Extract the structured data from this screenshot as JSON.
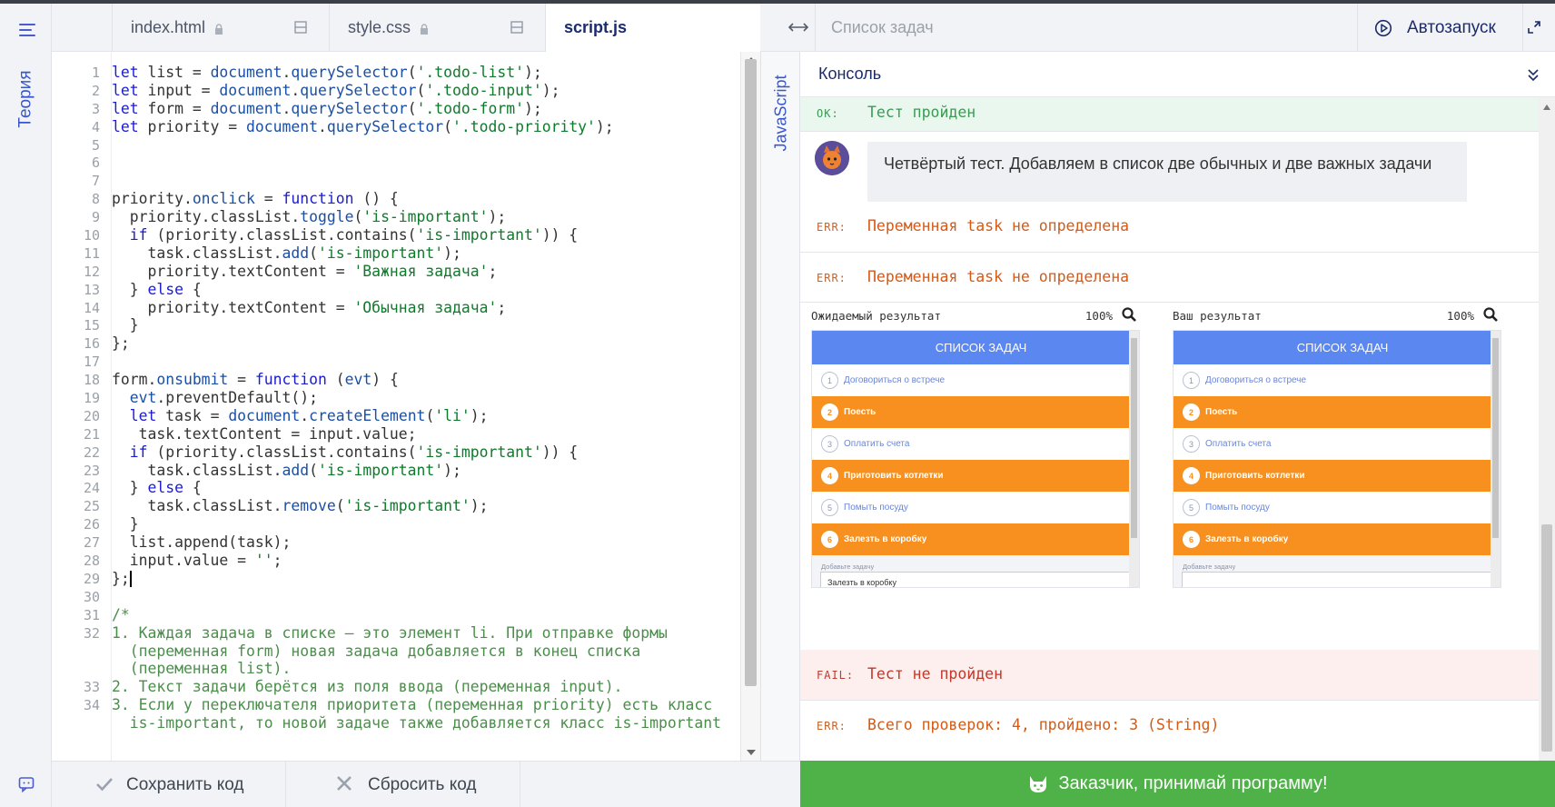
{
  "sidebar": {
    "theory_label": "Теория"
  },
  "editor": {
    "tabs": [
      {
        "label": "index.html"
      },
      {
        "label": "style.css"
      },
      {
        "label": "script.js"
      }
    ],
    "line_numbers": [
      "1",
      "2",
      "3",
      "4",
      "5",
      "6",
      "7",
      "8",
      "9",
      "10",
      "11",
      "12",
      "13",
      "14",
      "15",
      "16",
      "17",
      "18",
      "19",
      "20",
      "21",
      "22",
      "23",
      "24",
      "25",
      "26",
      "27",
      "28",
      "29",
      "30",
      "31",
      "32",
      "",
      "",
      "33",
      "34",
      ""
    ],
    "code_lines": [
      "let list = document.querySelector('.todo-list');",
      "let input = document.querySelector('.todo-input');",
      "let form = document.querySelector('.todo-form');",
      "let priority = document.querySelector('.todo-priority');",
      "",
      "",
      "",
      "priority.onclick = function () {",
      "  priority.classList.toggle('is-important');",
      "  if (priority.classList.contains('is-important')) {",
      "    task.classList.add('is-important');",
      "    priority.textContent = 'Важная задача';",
      "  } else {",
      "    priority.textContent = 'Обычная задача';",
      "  }",
      "};",
      "",
      "form.onsubmit = function (evt) {",
      "  evt.preventDefault();",
      "  let task = document.createElement('li');",
      "   task.textContent = input.value;",
      "  if (priority.classList.contains('is-important')) {",
      "    task.classList.add('is-important');",
      "  } else {",
      "    task.classList.remove('is-important');",
      "  }",
      "  list.append(task);",
      "  input.value = '';",
      "};",
      "",
      "/*",
      "1. Каждая задача в списке — это элемент li. При отправке формы",
      "  (переменная form) новая задача добавляется в конец списка",
      "  (переменная list).",
      "2. Текст задачи берётся из поля ввода (переменная input).",
      "3. Если у переключателя приоритета (переменная priority) есть класс",
      "  is-important, то новой задаче также добавляется класс is-important"
    ],
    "save_label": "Сохранить код",
    "reset_label": "Сбросить код",
    "language_label": "JavaScript"
  },
  "preview_bar": {
    "title": "Список задач",
    "autorun_label": "Автозапуск"
  },
  "console": {
    "title": "Консоль",
    "rows": [
      {
        "tag": "OK:",
        "text": "Тест пройден"
      },
      {
        "speaker": "Четвёртый тест. Добавляем в список две обычных и две важных задачи"
      },
      {
        "tag": "ERR:",
        "text": "Переменная task не определена"
      },
      {
        "tag": "ERR:",
        "text": "Переменная task не определена"
      },
      {
        "tag": "FAIL:",
        "text": "Тест не пройден"
      },
      {
        "tag": "ERR:",
        "text": "Всего проверок: 4, пройдено: 3 (String)"
      }
    ]
  },
  "expected": {
    "label": "Ожидаемый результат",
    "zoom": "100%",
    "header": "СПИСОК ЗАДАЧ",
    "items": [
      {
        "num": "1",
        "text": "Договориться о встрече",
        "important": false
      },
      {
        "num": "2",
        "text": "Поесть",
        "important": true
      },
      {
        "num": "3",
        "text": "Оплатить счета",
        "important": false
      },
      {
        "num": "4",
        "text": "Приготовить котлетки",
        "important": true
      },
      {
        "num": "5",
        "text": "Помыть посуду",
        "important": false
      },
      {
        "num": "6",
        "text": "Залезть в коробку",
        "important": true
      }
    ],
    "add_label": "Добавьте задачу",
    "input_value": "Залезть в коробку"
  },
  "actual": {
    "label": "Ваш результат",
    "zoom": "100%",
    "header": "СПИСОК ЗАДАЧ",
    "items": [
      {
        "num": "1",
        "text": "Договориться о встрече",
        "important": false
      },
      {
        "num": "2",
        "text": "Поесть",
        "important": true
      },
      {
        "num": "3",
        "text": "Оплатить счета",
        "important": false
      },
      {
        "num": "4",
        "text": "Приготовить котлетки",
        "important": true
      },
      {
        "num": "5",
        "text": "Помыть посуду",
        "important": false
      },
      {
        "num": "6",
        "text": "Залезть в коробку",
        "important": true
      }
    ],
    "add_label": "Добавьте задачу",
    "input_value": ""
  },
  "accept_label": "Заказчик, принимай программу!"
}
